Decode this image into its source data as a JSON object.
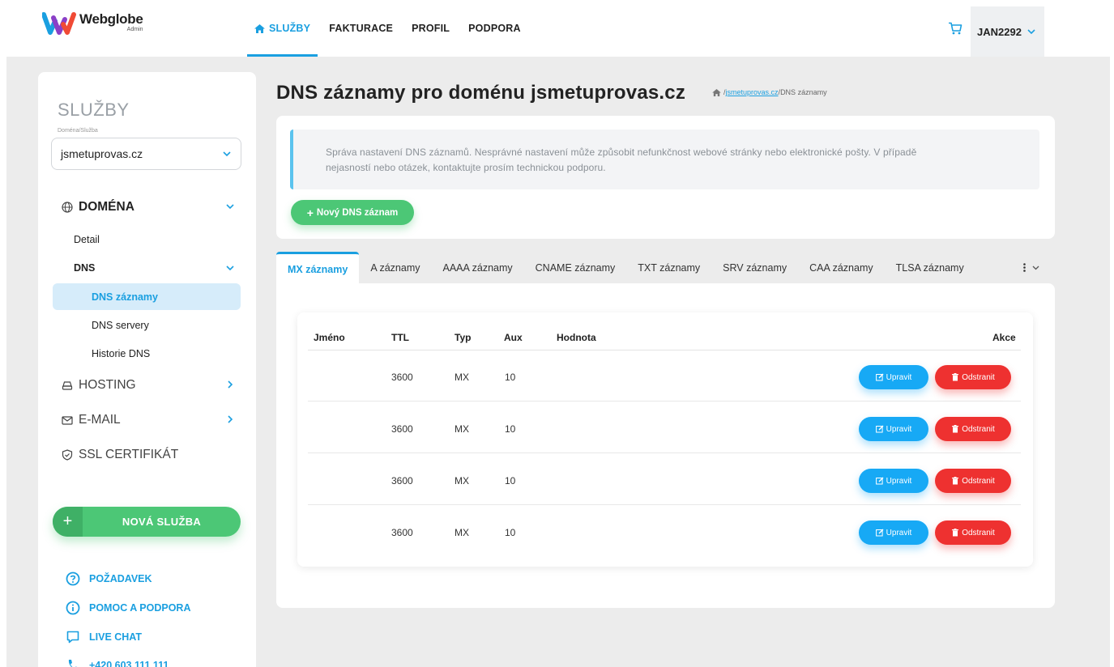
{
  "colors": {
    "accent": "#1a9fe0",
    "green": "#4cc776",
    "danger": "#ee3130",
    "edit": "#17a9f5"
  },
  "header": {
    "brand": "Webglobe",
    "brand_sub": "Admin",
    "nav": [
      {
        "label": "SLUŽBY",
        "icon": "home-icon",
        "active": true
      },
      {
        "label": "FAKTURACE"
      },
      {
        "label": "PROFIL"
      },
      {
        "label": "PODPORA"
      }
    ],
    "user": "JAN2292"
  },
  "sidebar": {
    "title": "SLUŽBY",
    "subtitle": "Doména/Služba",
    "domain_select": "jsmetuprovas.cz",
    "sections": {
      "domain": "DOMÉNA",
      "detail": "Detail",
      "dns": "DNS",
      "dns_records": "DNS záznamy",
      "dns_servers": "DNS servery",
      "dns_history": "Historie DNS",
      "hosting": "HOSTING",
      "email": "E-MAIL",
      "ssl": "SSL CERTIFIKÁT"
    },
    "new_service": "NOVÁ SLUŽBA",
    "links": {
      "request": "POŽADAVEK",
      "help": "POMOC A PODPORA",
      "chat": "LIVE CHAT",
      "phone": "+420 603 111 111"
    }
  },
  "page": {
    "title": "DNS záznamy pro doménu jsmetuprovas.cz",
    "breadcrumb": {
      "sep1": " / ",
      "link": "jsmetuprovas.cz",
      "sep2": " / ",
      "current": "DNS záznamy"
    },
    "alert_line1": "Správa nastavení DNS záznamů. Nesprávné nastavení může způsobit nefunkčnost webové stránky nebo elektronické pošty. V případě",
    "alert_line2": "nejasností nebo otázek, kontaktujte prosím technickou podporu.",
    "new_record_button": "Nový DNS záznam"
  },
  "tabs": [
    "MX záznamy",
    "A záznamy",
    "AAAA záznamy",
    "CNAME záznamy",
    "TXT záznamy",
    "SRV záznamy",
    "CAA záznamy",
    "TLSA záznamy"
  ],
  "table": {
    "columns": {
      "name": "Jméno",
      "ttl": "TTL",
      "type": "Typ",
      "aux": "Aux",
      "value": "Hodnota",
      "actions": "Akce"
    },
    "rows": [
      {
        "name": "",
        "ttl": "3600",
        "type": "MX",
        "aux": "10",
        "value": ""
      },
      {
        "name": "",
        "ttl": "3600",
        "type": "MX",
        "aux": "10",
        "value": ""
      },
      {
        "name": "",
        "ttl": "3600",
        "type": "MX",
        "aux": "10",
        "value": ""
      },
      {
        "name": "",
        "ttl": "3600",
        "type": "MX",
        "aux": "10",
        "value": ""
      }
    ],
    "edit_label": "Upravit",
    "delete_label": "Odstranit"
  }
}
